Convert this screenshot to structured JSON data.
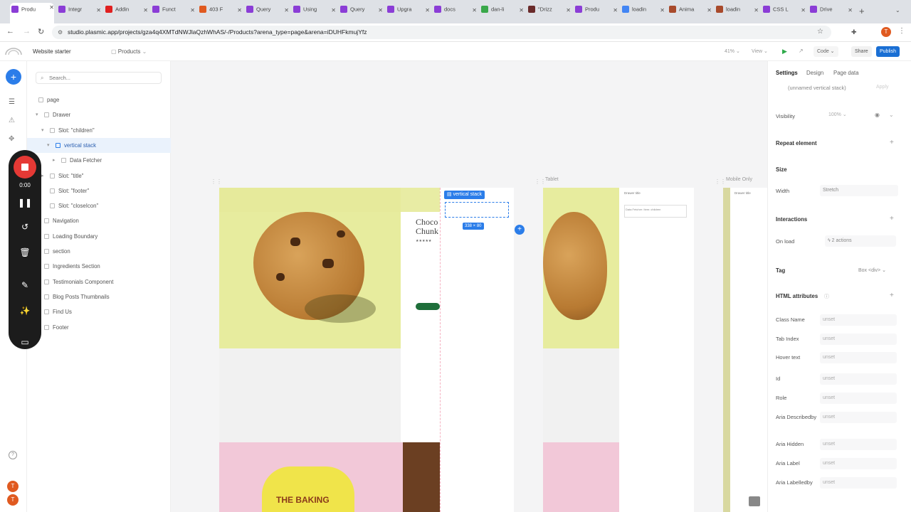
{
  "browser": {
    "tabs": [
      {
        "label": "Produ",
        "color": "#8b3dd6",
        "active": true
      },
      {
        "label": "Integr",
        "color": "#8b3dd6"
      },
      {
        "label": "Addin",
        "color": "#e02020"
      },
      {
        "label": "Funct",
        "color": "#8b3dd6"
      },
      {
        "label": "403 F",
        "color": "#e05a20"
      },
      {
        "label": "Query",
        "color": "#8b3dd6"
      },
      {
        "label": "Using",
        "color": "#8b3dd6"
      },
      {
        "label": "Query",
        "color": "#8b3dd6"
      },
      {
        "label": "Upgra",
        "color": "#8b3dd6"
      },
      {
        "label": "docs",
        "color": "#8b3dd6"
      },
      {
        "label": "dan-li",
        "color": "#3aa84a"
      },
      {
        "label": "\"Drizz",
        "color": "#6a2b2b"
      },
      {
        "label": "Produ",
        "color": "#8b3dd6"
      },
      {
        "label": "loadin",
        "color": "#4285f4"
      },
      {
        "label": "Anima",
        "color": "#a84a2b"
      },
      {
        "label": "loadin",
        "color": "#a84a2b"
      },
      {
        "label": "CSS L",
        "color": "#8b3dd6"
      },
      {
        "label": "Drive",
        "color": "#8b3dd6"
      }
    ],
    "url": "studio.plasmic.app/projects/gza4q4XMTdNWJlaQzhWhAS/-/Products?arena_type=page&arena=iDUHFkmujYfz"
  },
  "header": {
    "project_name": "Website starter",
    "page_name": "Products",
    "zoom": "41%",
    "view_label": "View",
    "code_label": "Code",
    "share_label": "Share",
    "publish_label": "Publish"
  },
  "search": {
    "placeholder": "Search..."
  },
  "tree": [
    {
      "label": "page",
      "indent": 0,
      "chev": "",
      "sel": false
    },
    {
      "label": "Drawer",
      "indent": 1,
      "chev": "▾",
      "sel": false
    },
    {
      "label": "Slot: \"children\"",
      "indent": 2,
      "chev": "▾",
      "sel": false
    },
    {
      "label": "vertical stack",
      "indent": 3,
      "chev": "▾",
      "sel": true
    },
    {
      "label": "Data Fetcher",
      "indent": 4,
      "chev": "▸",
      "sel": false
    },
    {
      "label": "Slot: \"title\"",
      "indent": 2,
      "chev": "▸",
      "sel": false
    },
    {
      "label": "Slot: \"footer\"",
      "indent": 2,
      "chev": "",
      "sel": false
    },
    {
      "label": "Slot: \"closeIcon\"",
      "indent": 2,
      "chev": "",
      "sel": false
    },
    {
      "label": "Navigation",
      "indent": 1,
      "chev": "",
      "sel": false
    },
    {
      "label": "Loading Boundary",
      "indent": 1,
      "chev": "",
      "sel": false
    },
    {
      "label": "section",
      "indent": 1,
      "chev": "",
      "sel": false
    },
    {
      "label": "Ingredients Section",
      "indent": 1,
      "chev": "",
      "sel": false
    },
    {
      "label": "Testimonials Component",
      "indent": 1,
      "chev": "",
      "sel": false
    },
    {
      "label": "Blog Posts Thumbnails",
      "indent": 1,
      "chev": "",
      "sel": false
    },
    {
      "label": "Find Us",
      "indent": 1,
      "chev": "",
      "sel": false
    },
    {
      "label": "Footer",
      "indent": 1,
      "chev": "",
      "sel": false
    }
  ],
  "recorder": {
    "timer": "0:00"
  },
  "canvas": {
    "selection_label": "vertical stack",
    "selection_size": "338 × 80",
    "frame_tablet_label": "Tablet",
    "frame_mobile_label": "Mobile Only",
    "hero_title": "Choco Chunk",
    "drawer_title": "Drawer title",
    "drawer_text": "Data Fetcher: Item: children",
    "bag_text": "THE BAKING"
  },
  "panel": {
    "tabs": [
      "Settings",
      "Design",
      "Page data"
    ],
    "element_name": "(unnamed vertical stack)",
    "apply_label": "Apply",
    "visibility_label": "Visibility",
    "visibility_value": "100%",
    "repeat_label": "Repeat element",
    "size_label": "Size",
    "width_label": "Width",
    "width_value": "Stretch",
    "interactions_label": "Interactions",
    "onload_label": "On load",
    "onload_value": "2 actions",
    "tag_label": "Tag",
    "tag_value": "Box <div>",
    "html_attrs_label": "HTML attributes",
    "attrs": [
      {
        "label": "Class Name",
        "value": "unset"
      },
      {
        "label": "Tab Index",
        "value": "unset"
      },
      {
        "label": "Hover text",
        "value": "unset"
      },
      {
        "label": "Id",
        "value": "unset"
      },
      {
        "label": "Role",
        "value": "unset"
      },
      {
        "label": "Aria Describedby",
        "value": "unset"
      },
      {
        "label": "Aria Hidden",
        "value": "unset"
      },
      {
        "label": "Aria Label",
        "value": "unset"
      },
      {
        "label": "Aria Labelledby",
        "value": "unset"
      }
    ]
  },
  "colors": {
    "accent": "#2b7de9",
    "publish": "#1a6fd4",
    "record": "#e53935",
    "avatar": "#e05a20",
    "cookie_bg": "#e8eda0",
    "pink": "#f2c8d8"
  }
}
